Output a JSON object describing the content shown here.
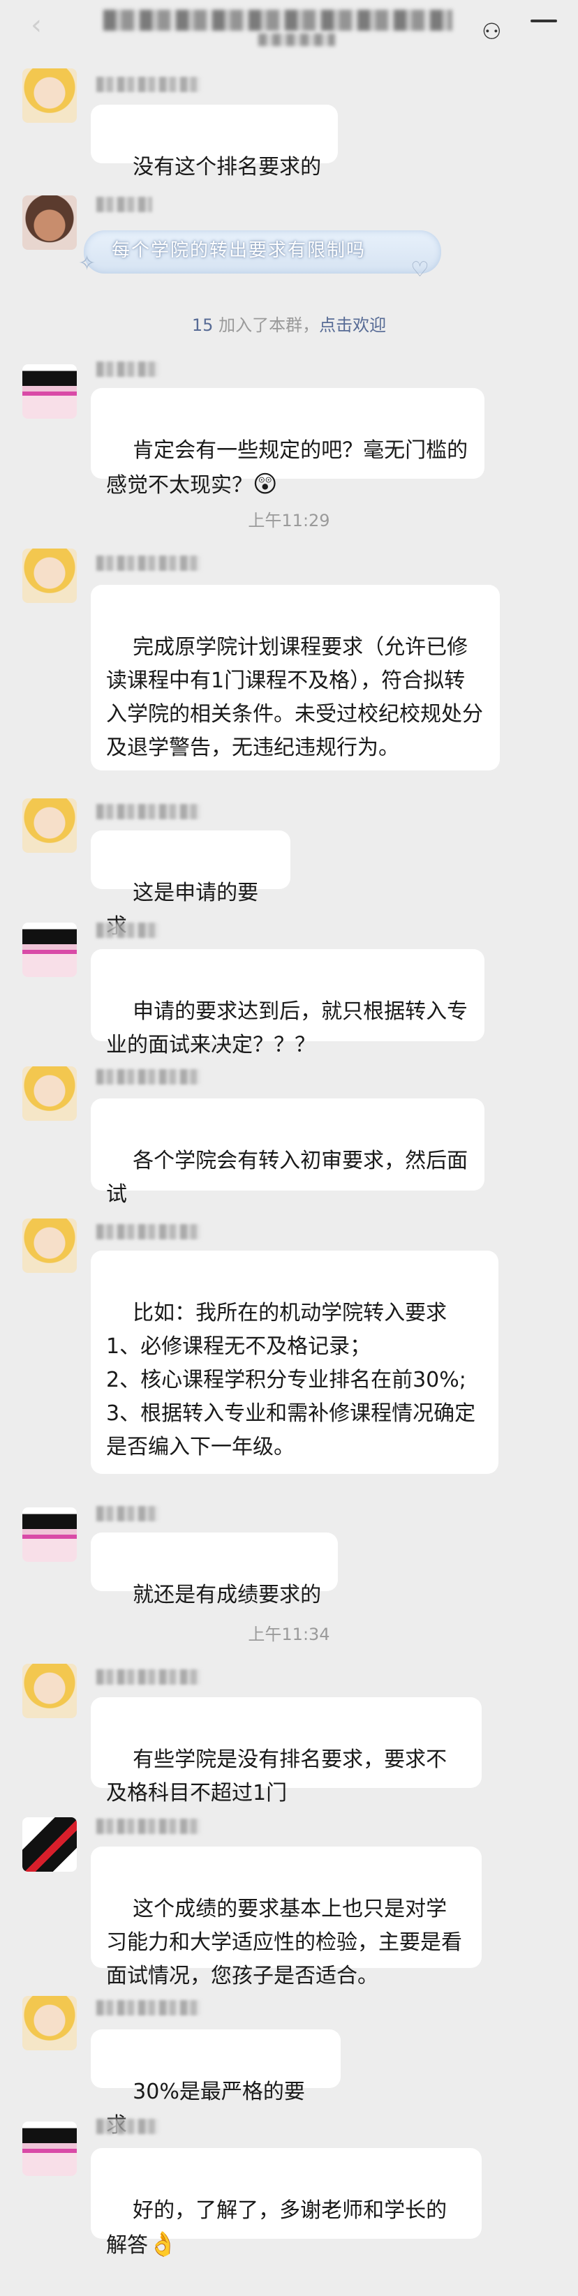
{
  "header": {
    "title_visible": false
  },
  "messages": [
    {
      "sender_type": "a1",
      "text": "没有这个排名要求的"
    },
    {
      "sender_type": "a3",
      "text": "每个学院的转出要求有限制吗"
    },
    {
      "sender_type": "a2",
      "text": "肯定会有一些规定的吧？毫无门槛的感觉不太现实？",
      "emoji": "😲"
    },
    {
      "sender_type": "a1",
      "text": "完成原学院计划课程要求（允许已修读课程中有1门课程不及格），符合拟转入学院的相关条件。未受过校纪校规处分及退学警告，无违纪违规行为。"
    },
    {
      "sender_type": "a1",
      "text": "这是申请的要求"
    },
    {
      "sender_type": "a2",
      "text": "申请的要求达到后，就只根据转入专业的面试来决定？？？"
    },
    {
      "sender_type": "a1",
      "text": "各个学院会有转入初审要求，然后面试"
    },
    {
      "sender_type": "a1",
      "text": "比如：我所在的机动学院转入要求\n1、必修课程无不及格记录；\n2、核心课程学积分专业排名在前30%;\n3、根据转入专业和需补修课程情况确定是否编入下一年级。"
    },
    {
      "sender_type": "a2",
      "text": "就还是有成绩要求的"
    },
    {
      "sender_type": "a1",
      "text": "有些学院是没有排名要求，要求不及格科目不超过1门"
    },
    {
      "sender_type": "a4",
      "text": "这个成绩的要求基本上也只是对学习能力和大学适应性的检验，主要是看面试情况，您孩子是否适合。"
    },
    {
      "sender_type": "a1",
      "text": "30%是最严格的要求"
    },
    {
      "sender_type": "a2",
      "text": "好的，了解了，多谢老师和学长的解答",
      "emoji": "👌"
    }
  ],
  "system_notice": {
    "count": "15",
    "text": " 加入了本群，",
    "action": "点击欢迎"
  },
  "timestamps": [
    "上午11:29",
    "上午11:34"
  ],
  "colors": {
    "background": "#ededed",
    "bubble": "#ffffff",
    "link": "#576b95",
    "muted": "#9a9a9a"
  }
}
